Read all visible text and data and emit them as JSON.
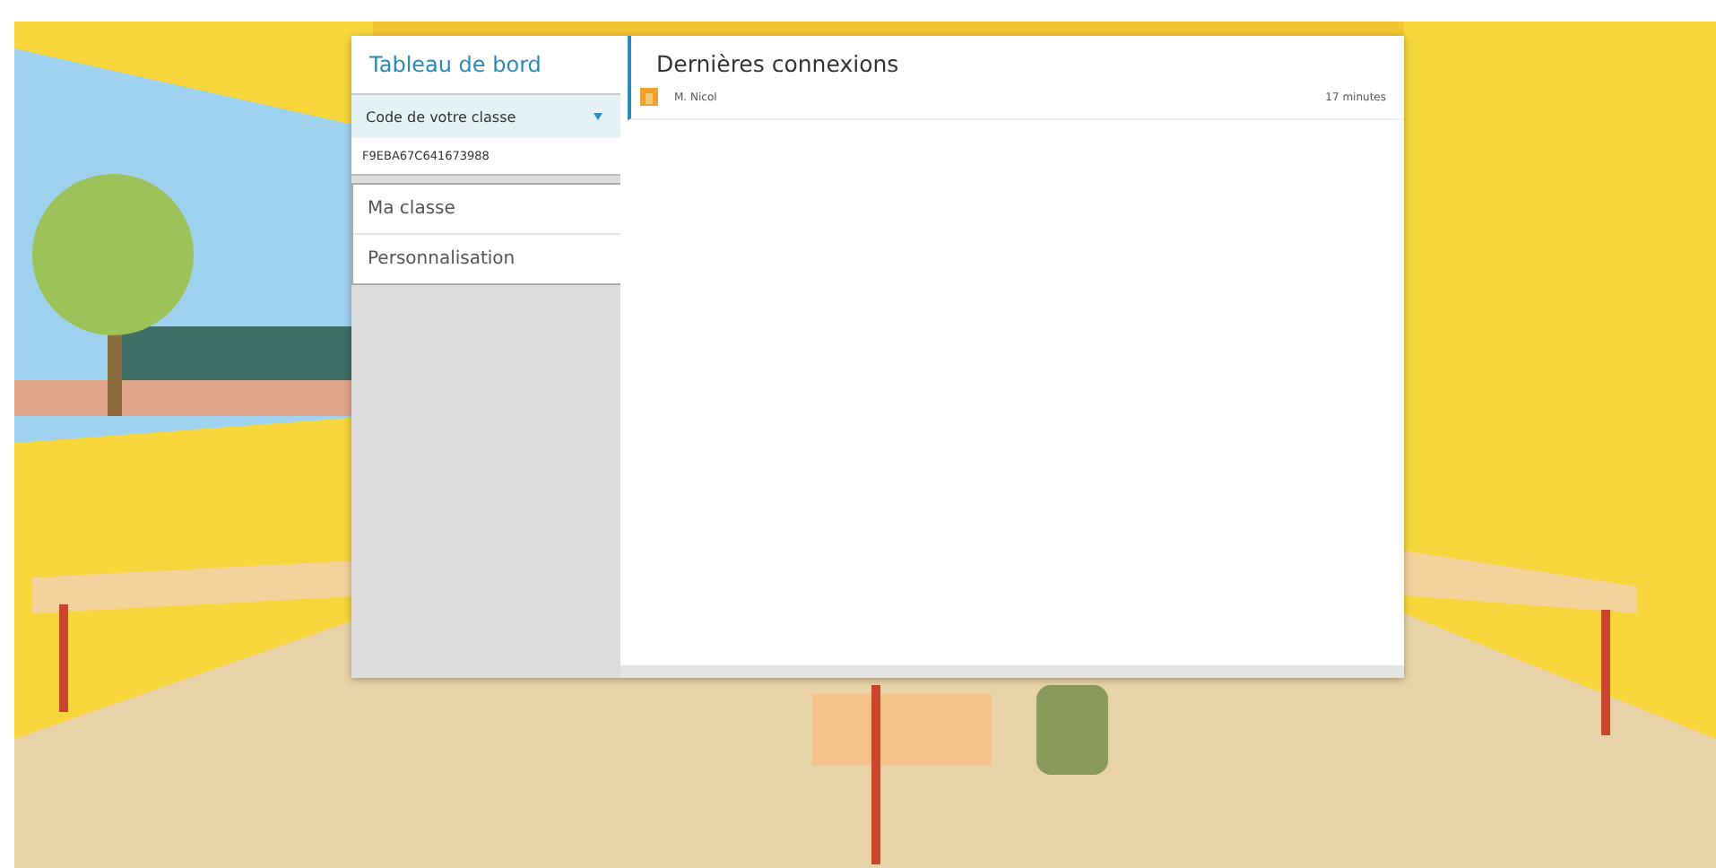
{
  "sidebar": {
    "header": "Tableau de bord",
    "class_code": {
      "label": "Code de votre classe",
      "value": "F9EBA67C641673988"
    },
    "items": [
      {
        "label": "Ma classe"
      },
      {
        "label": "Personnalisation"
      }
    ]
  },
  "main": {
    "title": "Dernières connexions",
    "connections": [
      {
        "name": "M. Nicol",
        "time": "17 minutes"
      }
    ]
  }
}
